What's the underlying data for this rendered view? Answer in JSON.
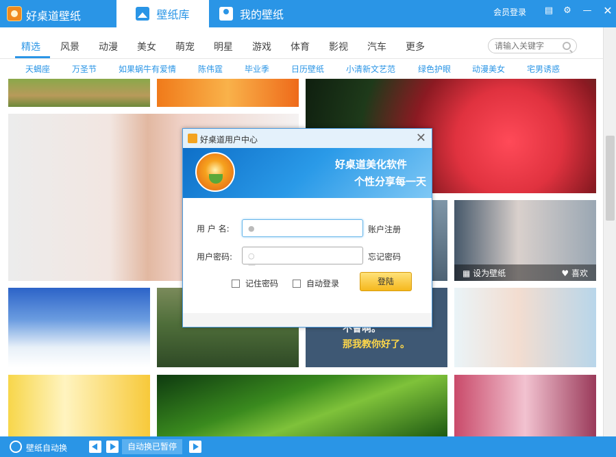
{
  "app": {
    "title": "好桌道壁纸"
  },
  "tabs": [
    {
      "label": "壁纸库",
      "icon": "image-icon",
      "active": true
    },
    {
      "label": "我的壁纸",
      "icon": "user-icon",
      "active": false
    }
  ],
  "header": {
    "member_login": "会员登录",
    "icons": [
      "chat-icon",
      "gear-icon",
      "minimize-icon",
      "close-icon"
    ]
  },
  "categories": [
    "精选",
    "风景",
    "动漫",
    "美女",
    "萌宠",
    "明星",
    "游戏",
    "体育",
    "影视",
    "汽车",
    "更多"
  ],
  "search": {
    "placeholder": "请输入关键字"
  },
  "tags": [
    "天蝎座",
    "万圣节",
    "如果蜗牛有爱情",
    "陈伟霆",
    "毕业季",
    "日历壁纸",
    "小清新文艺范",
    "绿色护眼",
    "动漫美女",
    "宅男诱惑"
  ],
  "tile_actions": {
    "set_wallpaper": "设为壁纸",
    "like": "喜欢"
  },
  "tile_texts": {
    "quote_line1": "不會啊。",
    "quote_line2": "那我教你好了。"
  },
  "bottom": {
    "auto_change": "壁纸自动换",
    "status": "自动换已暂停"
  },
  "dialog": {
    "title": "好桌道用户中心",
    "slogan1": "好桌道美化软件",
    "slogan2": "个性分享每一天",
    "username_label": "用 户 名:",
    "password_label": "用户密码:",
    "register": "账户注册",
    "forgot": "忘记密码",
    "remember": "记住密码",
    "auto_login": "自动登录",
    "login_button": "登陆"
  },
  "colors": {
    "accent": "#2a95e6",
    "login_button": "#f5b81d"
  }
}
